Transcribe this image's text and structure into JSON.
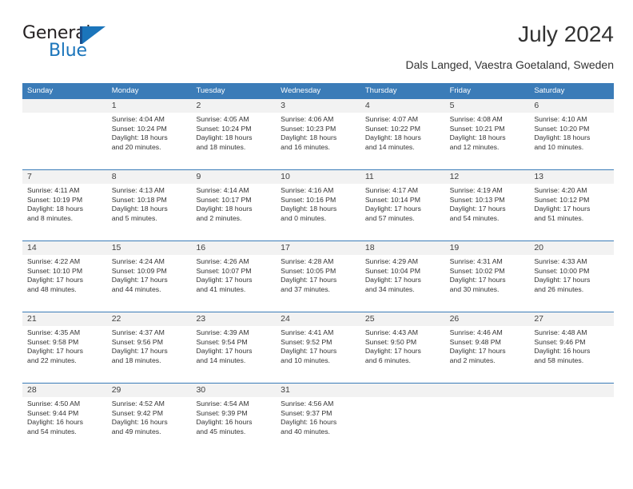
{
  "brand": {
    "name_top": "General",
    "name_bottom": "Blue",
    "logo_icon": "flag-triangle-icon",
    "color_dark": "#231f20",
    "color_blue": "#1b75bb"
  },
  "header": {
    "title": "July 2024",
    "subtitle": "Dals Langed, Vaestra Goetaland, Sweden"
  },
  "theme": {
    "header_blue": "#3b7cb8",
    "daynum_bg": "#f2f2f2",
    "text": "#333333"
  },
  "weekdays": [
    "Sunday",
    "Monday",
    "Tuesday",
    "Wednesday",
    "Thursday",
    "Friday",
    "Saturday"
  ],
  "weeks": [
    [
      {
        "day": "",
        "lines": []
      },
      {
        "day": "1",
        "lines": [
          "Sunrise: 4:04 AM",
          "Sunset: 10:24 PM",
          "Daylight: 18 hours",
          "and 20 minutes."
        ]
      },
      {
        "day": "2",
        "lines": [
          "Sunrise: 4:05 AM",
          "Sunset: 10:24 PM",
          "Daylight: 18 hours",
          "and 18 minutes."
        ]
      },
      {
        "day": "3",
        "lines": [
          "Sunrise: 4:06 AM",
          "Sunset: 10:23 PM",
          "Daylight: 18 hours",
          "and 16 minutes."
        ]
      },
      {
        "day": "4",
        "lines": [
          "Sunrise: 4:07 AM",
          "Sunset: 10:22 PM",
          "Daylight: 18 hours",
          "and 14 minutes."
        ]
      },
      {
        "day": "5",
        "lines": [
          "Sunrise: 4:08 AM",
          "Sunset: 10:21 PM",
          "Daylight: 18 hours",
          "and 12 minutes."
        ]
      },
      {
        "day": "6",
        "lines": [
          "Sunrise: 4:10 AM",
          "Sunset: 10:20 PM",
          "Daylight: 18 hours",
          "and 10 minutes."
        ]
      }
    ],
    [
      {
        "day": "7",
        "lines": [
          "Sunrise: 4:11 AM",
          "Sunset: 10:19 PM",
          "Daylight: 18 hours",
          "and 8 minutes."
        ]
      },
      {
        "day": "8",
        "lines": [
          "Sunrise: 4:13 AM",
          "Sunset: 10:18 PM",
          "Daylight: 18 hours",
          "and 5 minutes."
        ]
      },
      {
        "day": "9",
        "lines": [
          "Sunrise: 4:14 AM",
          "Sunset: 10:17 PM",
          "Daylight: 18 hours",
          "and 2 minutes."
        ]
      },
      {
        "day": "10",
        "lines": [
          "Sunrise: 4:16 AM",
          "Sunset: 10:16 PM",
          "Daylight: 18 hours",
          "and 0 minutes."
        ]
      },
      {
        "day": "11",
        "lines": [
          "Sunrise: 4:17 AM",
          "Sunset: 10:14 PM",
          "Daylight: 17 hours",
          "and 57 minutes."
        ]
      },
      {
        "day": "12",
        "lines": [
          "Sunrise: 4:19 AM",
          "Sunset: 10:13 PM",
          "Daylight: 17 hours",
          "and 54 minutes."
        ]
      },
      {
        "day": "13",
        "lines": [
          "Sunrise: 4:20 AM",
          "Sunset: 10:12 PM",
          "Daylight: 17 hours",
          "and 51 minutes."
        ]
      }
    ],
    [
      {
        "day": "14",
        "lines": [
          "Sunrise: 4:22 AM",
          "Sunset: 10:10 PM",
          "Daylight: 17 hours",
          "and 48 minutes."
        ]
      },
      {
        "day": "15",
        "lines": [
          "Sunrise: 4:24 AM",
          "Sunset: 10:09 PM",
          "Daylight: 17 hours",
          "and 44 minutes."
        ]
      },
      {
        "day": "16",
        "lines": [
          "Sunrise: 4:26 AM",
          "Sunset: 10:07 PM",
          "Daylight: 17 hours",
          "and 41 minutes."
        ]
      },
      {
        "day": "17",
        "lines": [
          "Sunrise: 4:28 AM",
          "Sunset: 10:05 PM",
          "Daylight: 17 hours",
          "and 37 minutes."
        ]
      },
      {
        "day": "18",
        "lines": [
          "Sunrise: 4:29 AM",
          "Sunset: 10:04 PM",
          "Daylight: 17 hours",
          "and 34 minutes."
        ]
      },
      {
        "day": "19",
        "lines": [
          "Sunrise: 4:31 AM",
          "Sunset: 10:02 PM",
          "Daylight: 17 hours",
          "and 30 minutes."
        ]
      },
      {
        "day": "20",
        "lines": [
          "Sunrise: 4:33 AM",
          "Sunset: 10:00 PM",
          "Daylight: 17 hours",
          "and 26 minutes."
        ]
      }
    ],
    [
      {
        "day": "21",
        "lines": [
          "Sunrise: 4:35 AM",
          "Sunset: 9:58 PM",
          "Daylight: 17 hours",
          "and 22 minutes."
        ]
      },
      {
        "day": "22",
        "lines": [
          "Sunrise: 4:37 AM",
          "Sunset: 9:56 PM",
          "Daylight: 17 hours",
          "and 18 minutes."
        ]
      },
      {
        "day": "23",
        "lines": [
          "Sunrise: 4:39 AM",
          "Sunset: 9:54 PM",
          "Daylight: 17 hours",
          "and 14 minutes."
        ]
      },
      {
        "day": "24",
        "lines": [
          "Sunrise: 4:41 AM",
          "Sunset: 9:52 PM",
          "Daylight: 17 hours",
          "and 10 minutes."
        ]
      },
      {
        "day": "25",
        "lines": [
          "Sunrise: 4:43 AM",
          "Sunset: 9:50 PM",
          "Daylight: 17 hours",
          "and 6 minutes."
        ]
      },
      {
        "day": "26",
        "lines": [
          "Sunrise: 4:46 AM",
          "Sunset: 9:48 PM",
          "Daylight: 17 hours",
          "and 2 minutes."
        ]
      },
      {
        "day": "27",
        "lines": [
          "Sunrise: 4:48 AM",
          "Sunset: 9:46 PM",
          "Daylight: 16 hours",
          "and 58 minutes."
        ]
      }
    ],
    [
      {
        "day": "28",
        "lines": [
          "Sunrise: 4:50 AM",
          "Sunset: 9:44 PM",
          "Daylight: 16 hours",
          "and 54 minutes."
        ]
      },
      {
        "day": "29",
        "lines": [
          "Sunrise: 4:52 AM",
          "Sunset: 9:42 PM",
          "Daylight: 16 hours",
          "and 49 minutes."
        ]
      },
      {
        "day": "30",
        "lines": [
          "Sunrise: 4:54 AM",
          "Sunset: 9:39 PM",
          "Daylight: 16 hours",
          "and 45 minutes."
        ]
      },
      {
        "day": "31",
        "lines": [
          "Sunrise: 4:56 AM",
          "Sunset: 9:37 PM",
          "Daylight: 16 hours",
          "and 40 minutes."
        ]
      },
      {
        "day": "",
        "lines": []
      },
      {
        "day": "",
        "lines": []
      },
      {
        "day": "",
        "lines": []
      }
    ]
  ]
}
